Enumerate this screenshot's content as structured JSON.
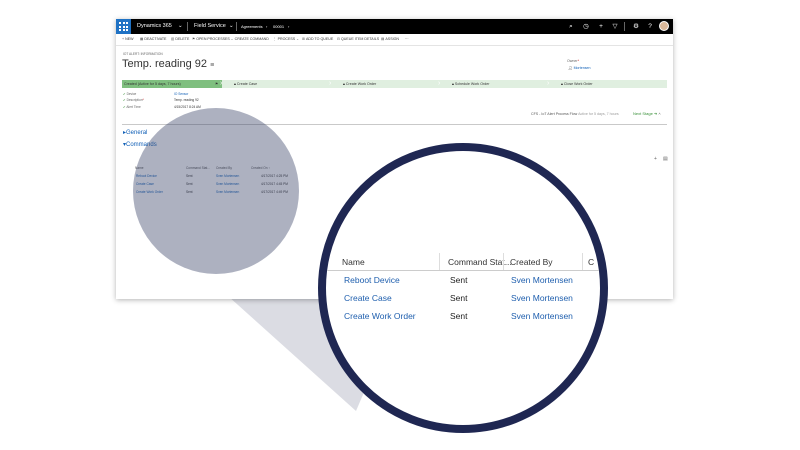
{
  "app": {
    "name": "Dynamics 365",
    "area": "Field Service",
    "breadcrumb": "Agreements",
    "record_number": "00001"
  },
  "commands": [
    "NEW",
    "DEACTIVATE",
    "DELETE",
    "OPEN PROCESSES",
    "CREATE COMMAND",
    "PROCESS",
    "ADD TO QUEUE",
    "QUEUE ITEM DETAILS",
    "ASSIGN"
  ],
  "record": {
    "entity_type": "IOT ALERT: INFORMATION",
    "title": "Temp. reading 92",
    "owner_label": "Owner",
    "owner_required_mark": "*",
    "owner_value": "Mortensen"
  },
  "stages": {
    "active": "Created (Active for 5 days, 7 hours)",
    "items": [
      "Create Case",
      "Create Work Order",
      "Schedule Work Order",
      "Close Work Order"
    ]
  },
  "fields": [
    {
      "label": "Device",
      "value": "IO Sensor",
      "link": true
    },
    {
      "label": "Description",
      "value": "Temp. reading 92",
      "link": false
    },
    {
      "label": "Alert Time",
      "value": "4/15/2017 8:24 AM",
      "link": false
    }
  ],
  "flow": {
    "name": "CFS - IoT Alert Process Flow",
    "age": "Active for 5 days, 7 hours",
    "next_stage": "Next Stage"
  },
  "sections": {
    "general": "General",
    "commands": "Commands"
  },
  "grid": {
    "columns": [
      "Name",
      "Command Stat...",
      "Created By",
      "Created On"
    ],
    "rows": [
      {
        "name": "Reboot Device",
        "status": "Sent",
        "created_by": "Sven Mortensen",
        "created_on": "4/17/2017 4:25 PM"
      },
      {
        "name": "Create Case",
        "status": "Sent",
        "created_by": "Sven Mortensen",
        "created_on": "4/17/2017 4:45 PM"
      },
      {
        "name": "Create Work Order",
        "status": "Sent",
        "created_by": "Sven Mortensen",
        "created_on": "4/17/2017 4:49 PM"
      }
    ]
  },
  "zoom": {
    "columns": [
      "Name",
      "Command Stat...",
      "Created By",
      "C"
    ],
    "rows": [
      {
        "name": "Reboot Device",
        "status": "Sent",
        "created_by": "Sven Mortensen"
      },
      {
        "name": "Create Case",
        "status": "Sent",
        "created_by": "Sven Mortensen"
      },
      {
        "name": "Create Work Order",
        "status": "Sent",
        "created_by": "Sven Mortensen"
      }
    ]
  },
  "colors": {
    "lens_ring": "#1f2752",
    "beam": "#d5d6de",
    "stage_active": "#7fbf7f",
    "stage_track": "#e0efe0",
    "link": "#1160b7",
    "waffle": "#1f72c4"
  },
  "icons": [
    "waffle-icon",
    "search-icon",
    "history-icon",
    "plus-icon",
    "filter-icon",
    "settings-icon",
    "help-icon"
  ]
}
